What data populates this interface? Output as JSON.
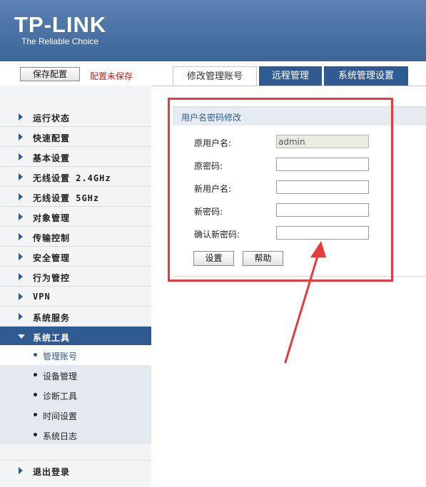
{
  "header": {
    "logo": "TP-LINK",
    "tagline": "The Reliable Choice"
  },
  "savebar": {
    "save_label": "保存配置",
    "status": "配置未保存"
  },
  "tabs": [
    {
      "label": "修改管理账号",
      "active": true
    },
    {
      "label": "远程管理",
      "active": false
    },
    {
      "label": "系统管理设置",
      "active": false
    }
  ],
  "sidebar": {
    "items": [
      {
        "label": "运行状态"
      },
      {
        "label": "快速配置"
      },
      {
        "label": "基本设置"
      },
      {
        "label": "无线设置 2.4GHz"
      },
      {
        "label": "无线设置 5GHz"
      },
      {
        "label": "对象管理"
      },
      {
        "label": "传输控制"
      },
      {
        "label": "安全管理"
      },
      {
        "label": "行为管控"
      },
      {
        "label": "VPN"
      },
      {
        "label": "系统服务"
      },
      {
        "label": "系统工具",
        "expanded": true
      }
    ],
    "subitems": [
      {
        "label": "管理账号",
        "active": true
      },
      {
        "label": "设备管理"
      },
      {
        "label": "诊断工具"
      },
      {
        "label": "时间设置"
      },
      {
        "label": "系统日志"
      }
    ],
    "logout": "退出登录"
  },
  "form": {
    "title": "用户名密码修改",
    "fields": [
      {
        "label": "原用户名:",
        "value": "admin",
        "disabled": true
      },
      {
        "label": "原密码:",
        "value": ""
      },
      {
        "label": "新用户名:",
        "value": ""
      },
      {
        "label": "新密码:",
        "value": ""
      },
      {
        "label": "确认新密码:",
        "value": ""
      }
    ],
    "set_label": "设置",
    "help_label": "帮助"
  },
  "colors": {
    "brand": "#2f5b92",
    "header": "#4a73a6",
    "unsaved": "#c51c1c",
    "annotation": "#e8393d"
  }
}
